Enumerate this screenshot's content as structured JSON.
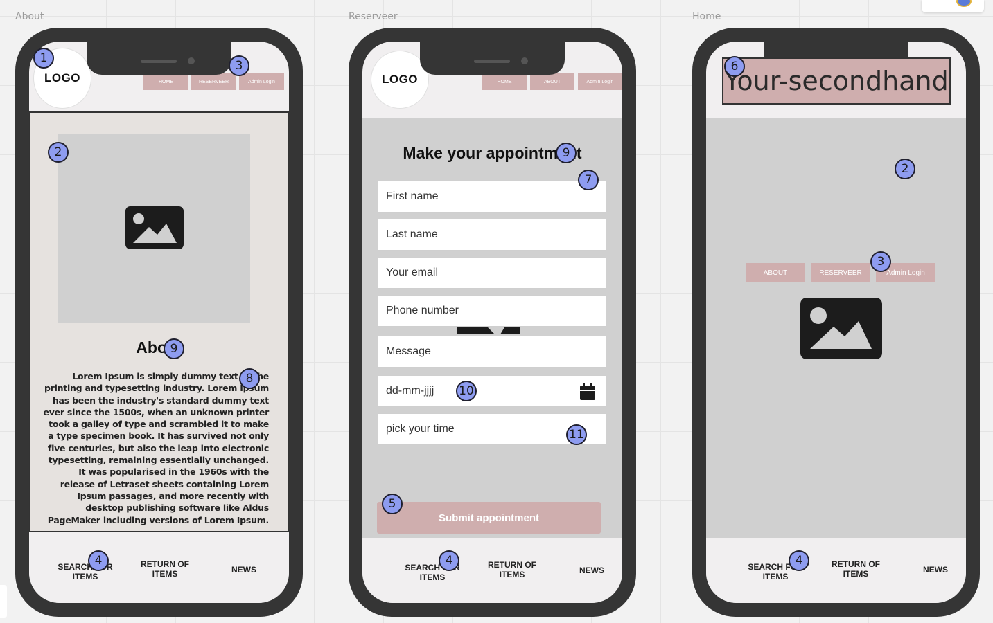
{
  "canvas": {
    "frames": [
      "About",
      "Reserveer",
      "Home"
    ]
  },
  "colors": {
    "nav_button": "#cfaeae",
    "phone_body": "#353535",
    "badge": "#8e9cf0",
    "content_grey": "#d0d0d0",
    "about_bg": "#e6e2df"
  },
  "about": {
    "logo": "LOGO",
    "nav": [
      "HOME",
      "RESERVEER",
      "Admin Login"
    ],
    "title": "About",
    "body": "Lorem Ipsum is simply dummy text of the printing and typesetting industry. Lorem Ipsum has been the industry's standard dummy text ever since the 1500s, when an unknown printer took a galley of type and scrambled it to make a type specimen book. It has survived not only five centuries, but also the leap into electronic typesetting, remaining essentially unchanged. It was popularised in the 1960s with the release of Letraset sheets containing Lorem Ipsum passages, and more recently with desktop publishing software like Aldus PageMaker including versions of Lorem Ipsum.",
    "footer": [
      "SEARCH FOR ITEMS",
      "RETURN OF ITEMS",
      "NEWS"
    ],
    "badges": [
      "1",
      "2",
      "3",
      "4",
      "8",
      "9"
    ]
  },
  "reserveer": {
    "logo": "LOGO",
    "nav": [
      "HOME",
      "ABOUT",
      "Admin Login"
    ],
    "title": "Make your appointment",
    "fields": [
      "First name",
      "Last name",
      "Your email",
      "Phone number",
      "Message",
      "dd-mm-jjjj",
      "pick your time"
    ],
    "submit": "Submit appointment",
    "footer": [
      "SEARCH FOR ITEMS",
      "RETURN OF ITEMS",
      "NEWS"
    ],
    "badges": [
      "9",
      "7",
      "10",
      "11",
      "5",
      "4"
    ]
  },
  "home": {
    "title": "Your-secondhand",
    "nav": [
      "ABOUT",
      "RESERVEER",
      "Admin Login"
    ],
    "footer": [
      "SEARCH FOR ITEMS",
      "RETURN OF ITEMS",
      "NEWS"
    ],
    "badges": [
      "6",
      "2",
      "3",
      "4"
    ]
  }
}
